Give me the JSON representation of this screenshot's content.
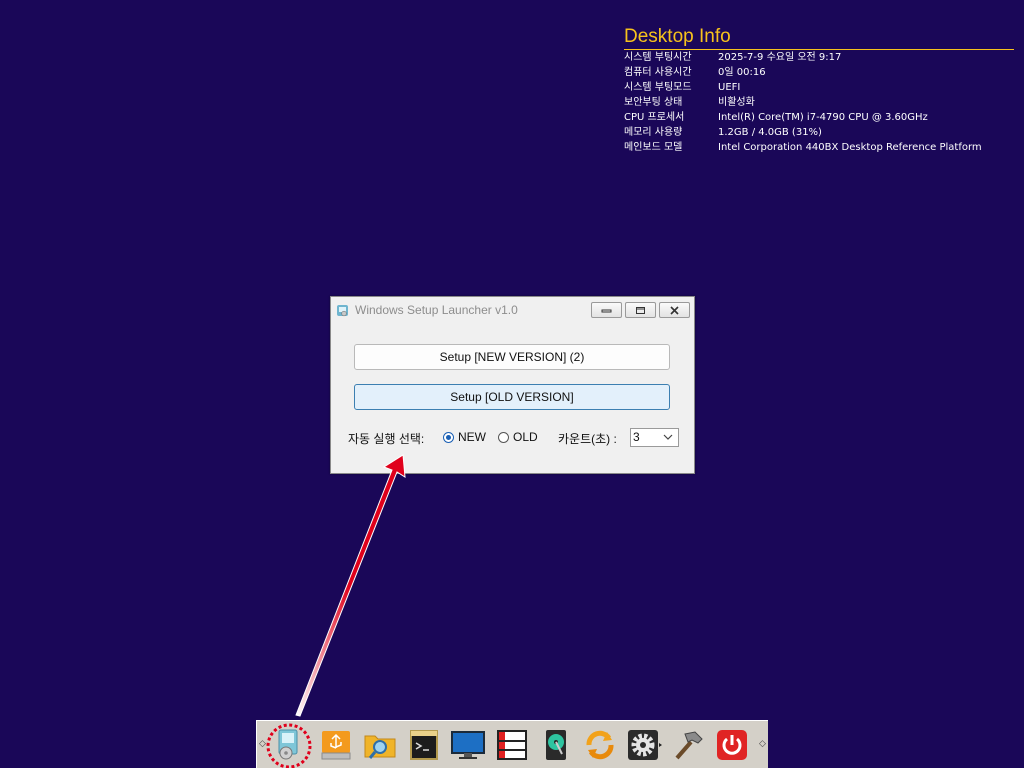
{
  "desktop_info": {
    "title": "Desktop Info",
    "rows": [
      {
        "label": "시스템 부팅시간",
        "value": "2025-7-9 수요일 오전 9:17"
      },
      {
        "label": "컴퓨터 사용시간",
        "value": "0일 00:16"
      },
      {
        "label": "시스템 부팅모드",
        "value": "UEFI"
      },
      {
        "label": "보안부팅 상태",
        "value": "비활성화"
      },
      {
        "label": "CPU 프로세서",
        "value": "Intel(R) Core(TM) i7-4790 CPU @ 3.60GHz"
      },
      {
        "label": "메모리 사용량",
        "value": "1.2GB / 4.0GB (31%)"
      },
      {
        "label": "메인보드 모델",
        "value": "Intel Corporation 440BX Desktop Reference Platform"
      }
    ]
  },
  "window": {
    "title": "Windows Setup Launcher v1.0",
    "new_button": "Setup [NEW VERSION] (2)",
    "old_button": "Setup [OLD VERSION]",
    "auto_label": "자동 실행 선택:",
    "radio_new": "NEW",
    "radio_old": "OLD",
    "selected": "NEW",
    "count_label": "카운트(초) :",
    "count_value": "3"
  },
  "taskbar": {
    "icons": [
      "setup-launcher-icon",
      "usb-drive-icon",
      "folder-search-icon",
      "command-prompt-icon",
      "monitor-icon",
      "disk-manager-icon",
      "hard-disk-icon",
      "sync-icon",
      "settings-gear-icon",
      "tools-hammer-icon",
      "power-icon"
    ]
  },
  "colors": {
    "desktop_bg": "#1a0758",
    "info_title": "#f7c21c",
    "annotation": "#e0001b"
  }
}
